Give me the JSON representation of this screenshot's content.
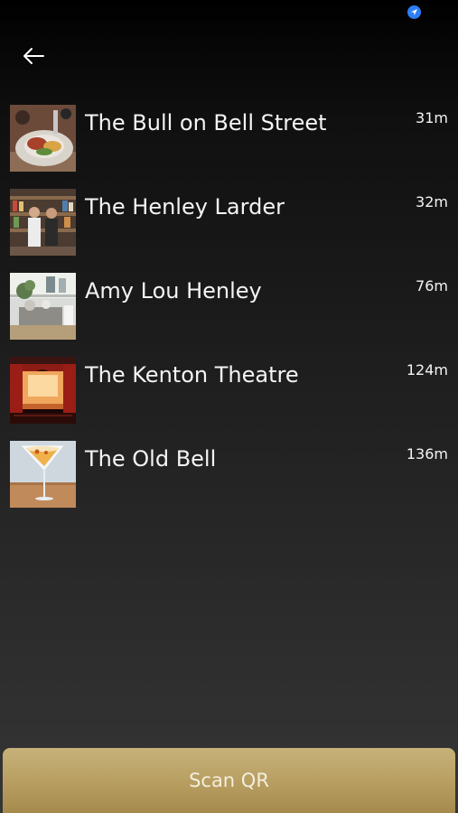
{
  "status_bar": {
    "location_icon": "location-arrow-icon",
    "accent": "#2d7ef7"
  },
  "header": {
    "back_icon": "back-arrow-icon"
  },
  "places": [
    {
      "name": "The Bull on Bell Street",
      "distance": "31m",
      "image": "plated-food-photo"
    },
    {
      "name": "The Henley Larder",
      "distance": "32m",
      "image": "shop-interior-photo"
    },
    {
      "name": "Amy Lou Henley",
      "distance": "76m",
      "image": "homeware-store-photo"
    },
    {
      "name": "The Kenton Theatre",
      "distance": "124m",
      "image": "theatre-stage-photo"
    },
    {
      "name": "The Old Bell",
      "distance": "136m",
      "image": "cocktail-glass-photo"
    }
  ],
  "footer": {
    "scan_label": "Scan QR",
    "button_color": "#b9a062"
  }
}
